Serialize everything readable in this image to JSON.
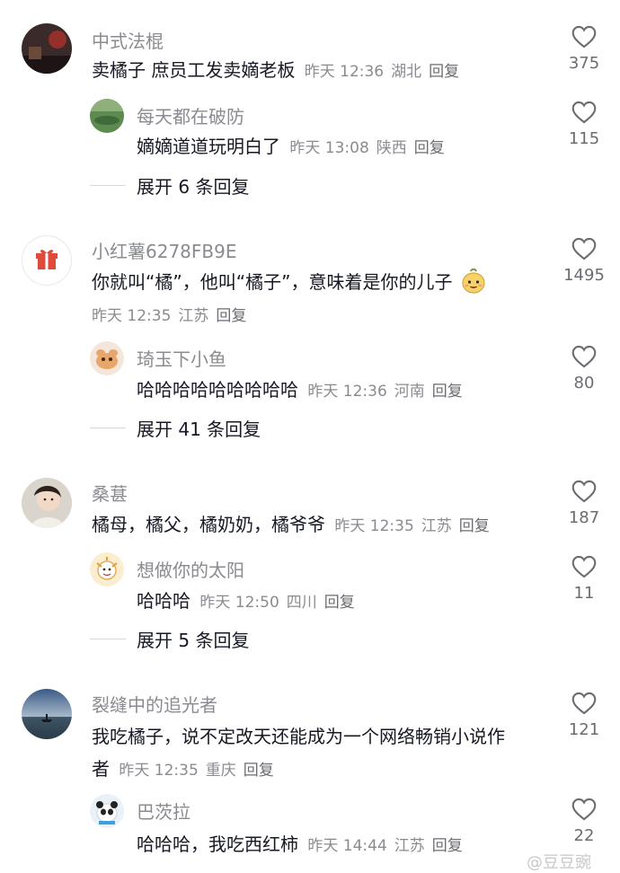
{
  "comments": [
    {
      "author": "中式法棍",
      "text": "卖橘子 庶员工发卖嫡老板",
      "meta": {
        "time": "昨天 12:36",
        "location": "湖北",
        "reply": "回复"
      },
      "likes": "375"
    },
    {
      "author": "每天都在破防",
      "text": "嫡嫡道道玩明白了",
      "meta": {
        "time": "昨天 13:08",
        "location": "陕西",
        "reply": "回复"
      },
      "likes": "115"
    },
    {
      "author": "小红薯6278FB9E",
      "text": "你就叫“橘”，他叫“橘子”，意味着是你的儿子",
      "meta": {
        "time": "昨天 12:35",
        "location": "江苏",
        "reply": "回复"
      },
      "likes": "1495"
    },
    {
      "author": "琦玉下小鱼",
      "text": "哈哈哈哈哈哈哈哈哈",
      "meta": {
        "time": "昨天 12:36",
        "location": "河南",
        "reply": "回复"
      },
      "likes": "80"
    },
    {
      "author": "桑葚",
      "text": "橘母，橘父，橘奶奶，橘爷爷",
      "meta": {
        "time": "昨天 12:35",
        "location": "江苏",
        "reply": "回复"
      },
      "likes": "187"
    },
    {
      "author": "想做你的太阳",
      "text": "哈哈哈",
      "meta": {
        "time": "昨天 12:50",
        "location": "四川",
        "reply": "回复"
      },
      "likes": "11"
    },
    {
      "author": "裂缝中的追光者",
      "text_line1": "我吃橘子，说不定改天还能成为一个网络畅销小说作",
      "text_line2": "者",
      "meta": {
        "time": "昨天 12:35",
        "location": "重庆",
        "reply": "回复"
      },
      "likes": "121"
    },
    {
      "author": "巴茨拉",
      "text": "哈哈哈，我吃西红柿",
      "meta": {
        "time": "昨天 14:44",
        "location": "江苏",
        "reply": "回复"
      },
      "likes": "22"
    }
  ],
  "expand": [
    "展开 6 条回复",
    "展开 41 条回复",
    "展开 5 条回复"
  ],
  "watermark": "@豆豆豌",
  "icons": {
    "like": "heart-outline-icon",
    "emoji": "smiling-emoji-icon",
    "gift": "gift-icon"
  }
}
